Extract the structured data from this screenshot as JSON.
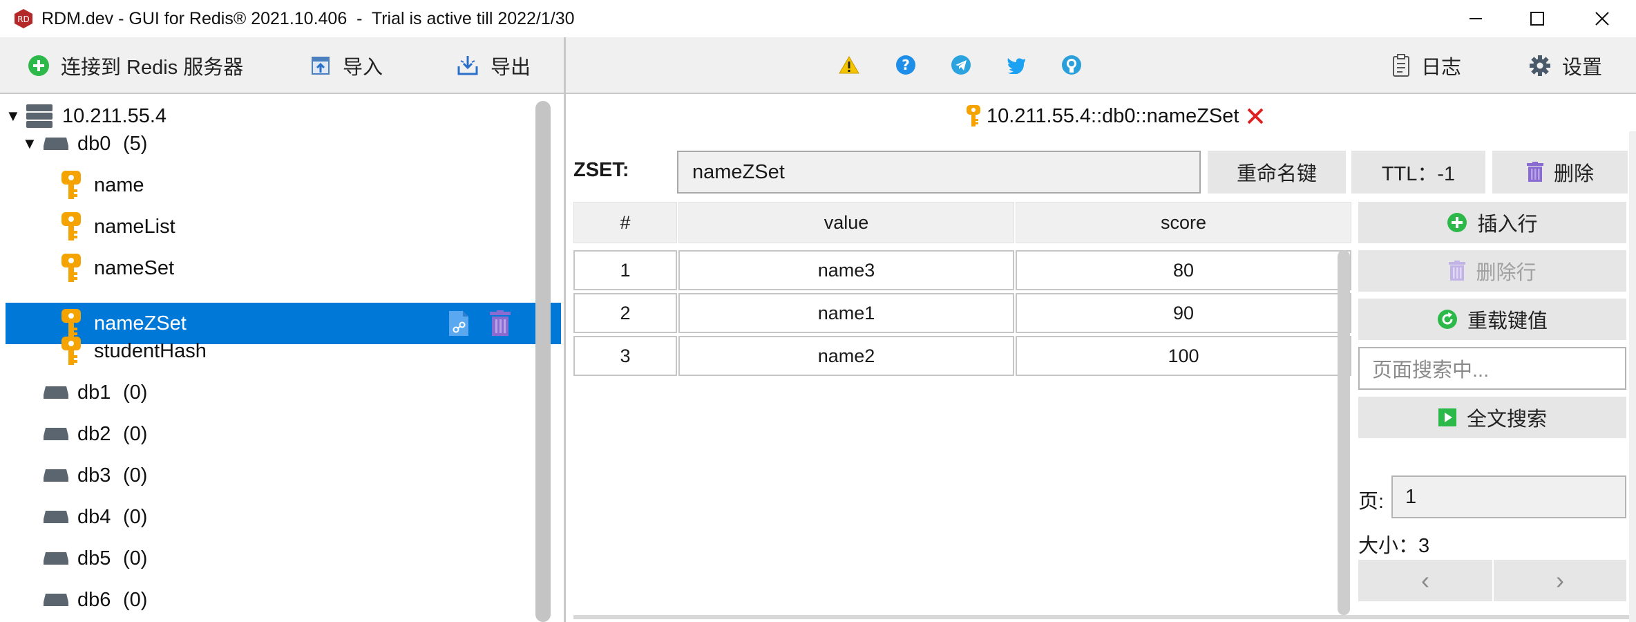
{
  "window": {
    "title": "RDM.dev - GUI for Redis® 2021.10.406  -  Trial is active till 2022/1/30"
  },
  "left_toolbar": {
    "connect_label": "连接到 Redis 服务器",
    "import_label": "导入",
    "export_label": "导出"
  },
  "right_toolbar": {
    "log_label": "日志",
    "settings_label": "设置",
    "icons": [
      "warning-icon",
      "help-icon",
      "telegram-icon",
      "twitter-icon",
      "github-icon"
    ]
  },
  "tree": {
    "server": "10.211.55.4",
    "db0": {
      "name": "db0",
      "count": "(5)"
    },
    "keys": [
      "name",
      "nameList",
      "nameSet",
      "nameZSet",
      "studentHash"
    ],
    "selected_key": "nameZSet",
    "databases": [
      {
        "name": "db1",
        "count": "(0)"
      },
      {
        "name": "db2",
        "count": "(0)"
      },
      {
        "name": "db3",
        "count": "(0)"
      },
      {
        "name": "db4",
        "count": "(0)"
      },
      {
        "name": "db5",
        "count": "(0)"
      },
      {
        "name": "db6",
        "count": "(0)"
      }
    ]
  },
  "tab": {
    "title": "10.211.55.4::db0::nameZSet"
  },
  "key_editor": {
    "type_label": "ZSET:",
    "key_name": "nameZSet",
    "rename_label": "重命名键",
    "ttl_label": "TTL：-1",
    "delete_label": "删除"
  },
  "table": {
    "headers": [
      "#",
      "value",
      "score"
    ],
    "rows": [
      [
        "1",
        "name3",
        "80"
      ],
      [
        "2",
        "name1",
        "90"
      ],
      [
        "3",
        "name2",
        "100"
      ]
    ]
  },
  "side_panel": {
    "insert_row_label": "插入行",
    "delete_row_label": "删除行",
    "reload_label": "重载键值",
    "search_placeholder": "页面搜索中...",
    "fulltext_label": "全文搜索",
    "page_label": "页:",
    "page_value": "1",
    "size_label": "大小：3",
    "prev_label": "‹",
    "next_label": "›"
  },
  "colors": {
    "selection": "#0078d7",
    "key_icon": "#f5a300",
    "delete_icon": "#8a6bd0",
    "add_icon": "#2db84a",
    "close_x": "#e02020"
  }
}
